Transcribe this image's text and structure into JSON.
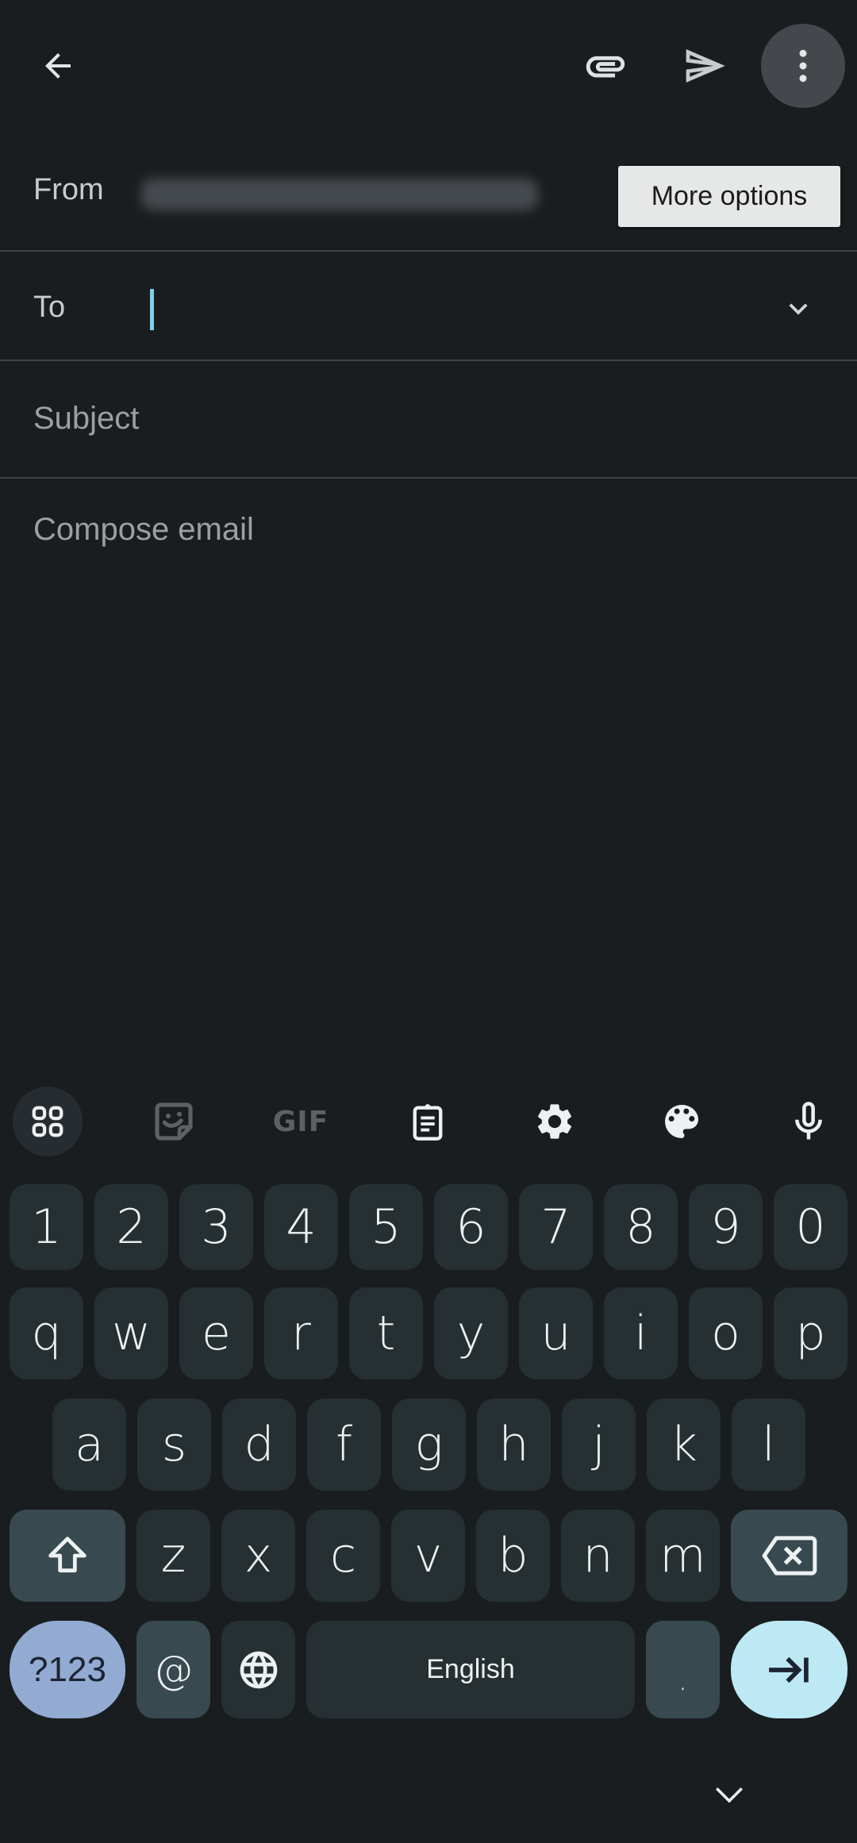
{
  "app_bar": {
    "back_icon": "arrow-back-icon",
    "attach_icon": "paperclip-icon",
    "send_icon": "send-icon",
    "more_icon": "more-vert-icon",
    "tooltip": "More options"
  },
  "compose": {
    "from_label": "From",
    "from_value_redacted": true,
    "to_label": "To",
    "to_value": "",
    "subject_placeholder": "Subject",
    "body_placeholder": "Compose email"
  },
  "keyboard": {
    "toolbar": [
      {
        "name": "apps-grid-icon",
        "enabled": true
      },
      {
        "name": "sticker-icon",
        "enabled": false
      },
      {
        "name": "gif-icon",
        "label": "GIF",
        "enabled": false
      },
      {
        "name": "clipboard-icon",
        "enabled": true
      },
      {
        "name": "settings-icon",
        "enabled": true
      },
      {
        "name": "palette-icon",
        "enabled": true
      },
      {
        "name": "microphone-icon",
        "enabled": true
      }
    ],
    "number_row": [
      "1",
      "2",
      "3",
      "4",
      "5",
      "6",
      "7",
      "8",
      "9",
      "0"
    ],
    "row1": [
      "q",
      "w",
      "e",
      "r",
      "t",
      "y",
      "u",
      "i",
      "o",
      "p"
    ],
    "row2": [
      "a",
      "s",
      "d",
      "f",
      "g",
      "h",
      "j",
      "k",
      "l"
    ],
    "row3": [
      "z",
      "x",
      "c",
      "v",
      "b",
      "n",
      "m"
    ],
    "symbols_label": "?123",
    "at_label": "@",
    "space_label": "English",
    "period_label": ".",
    "shift_icon": "shift-icon",
    "backspace_icon": "backspace-icon",
    "globe_icon": "globe-icon",
    "next_icon": "tab-next-icon",
    "hide_icon": "chevron-down-icon"
  },
  "colors": {
    "background": "#191d20",
    "key": "#263033",
    "function_key": "#384a50",
    "symbols_key": "#93abd3",
    "action_key": "#bde9f5",
    "cursor": "#7fcfe8"
  }
}
